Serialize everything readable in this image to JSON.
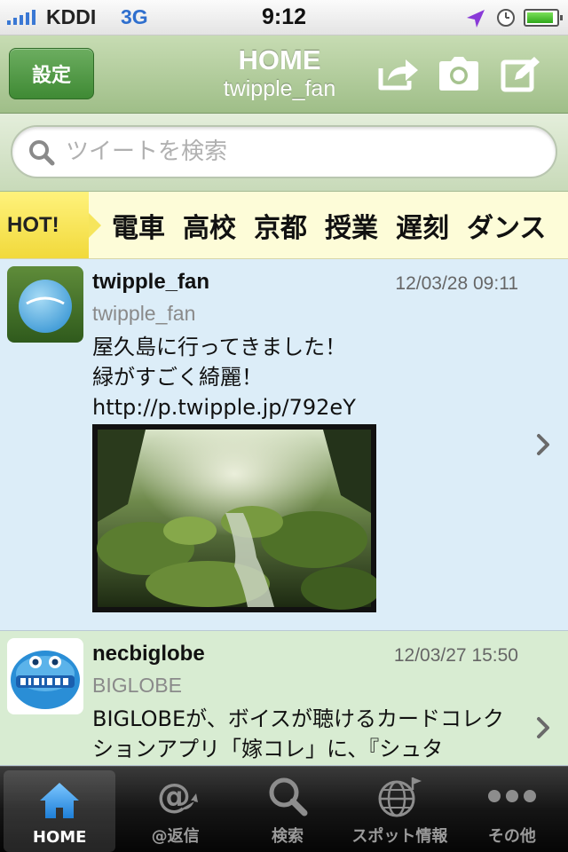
{
  "status": {
    "carrier": "KDDI",
    "network": "3G",
    "time": "9:12",
    "battery_level": 0.9
  },
  "nav": {
    "settings_label": "設定",
    "title": "HOME",
    "subtitle": "twipple_fan",
    "icons": [
      "share-icon",
      "camera-icon",
      "compose-icon"
    ]
  },
  "search": {
    "placeholder": "ツイートを検索"
  },
  "hot": {
    "label": "HOT!",
    "words": [
      "電車",
      "高校",
      "京都",
      "授業",
      "遅刻",
      "ダンス"
    ]
  },
  "tweets": [
    {
      "name": "twipple_fan",
      "handle": "twipple_fan",
      "date": "12/03/28 09:11",
      "body": "屋久島に行ってきました！\n緑がすごく綺麗！\nhttp://p.twipple.jp/792eY"
    },
    {
      "name": "necbiglobe",
      "handle": "BIGLOBE",
      "date": "12/03/27 15:50",
      "body": "BIGLOBEが、ボイスが聴けるカードコレクションアプリ「嫁コレ」に、『シュタ"
    }
  ],
  "tabs": [
    {
      "label": "HOME",
      "icon": "home-icon",
      "active": true
    },
    {
      "label": "@返信",
      "icon": "at-reply-icon",
      "active": false
    },
    {
      "label": "検索",
      "icon": "search-icon",
      "active": false
    },
    {
      "label": "スポット情報",
      "icon": "globe-icon",
      "active": false
    },
    {
      "label": "その他",
      "icon": "more-icon",
      "active": false
    }
  ],
  "colors": {
    "nav_green": "#9fbe88",
    "button_green": "#3f8a34",
    "tweet1_bg": "#dcedf8",
    "tweet2_bg": "#d8ecd2",
    "hot_yellow": "#f1d93a",
    "network_blue": "#2f6fce"
  }
}
